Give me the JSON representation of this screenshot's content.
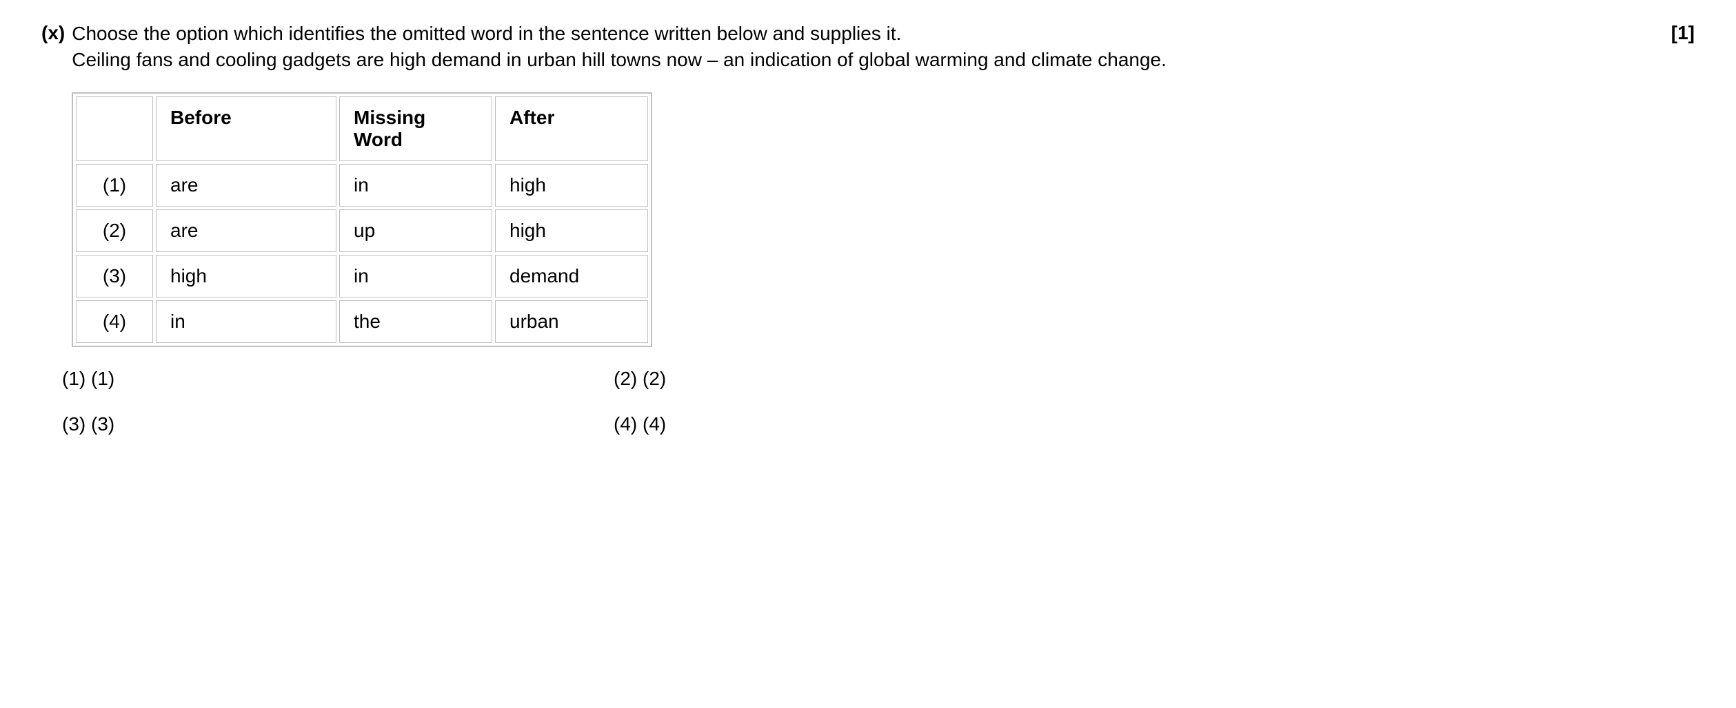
{
  "question": {
    "number": "(x)",
    "prompt": "Choose the option which identifies the omitted word in the sentence written below and supplies it.",
    "sentence": "Ceiling fans and cooling gadgets are high demand in urban hill towns now – an indication of global warming and climate change.",
    "marks": "[1]"
  },
  "table": {
    "headers": {
      "blank": "",
      "before": "Before",
      "missing": "Missing Word",
      "after": "After"
    },
    "rows": [
      {
        "label": "(1)",
        "before": "are",
        "missing": "in",
        "after": "high"
      },
      {
        "label": "(2)",
        "before": "are",
        "missing": "up",
        "after": "high"
      },
      {
        "label": "(3)",
        "before": "high",
        "missing": "in",
        "after": "demand"
      },
      {
        "label": "(4)",
        "before": "in",
        "missing": "the",
        "after": "urban"
      }
    ]
  },
  "answers": [
    {
      "num": "(1)",
      "text": "(1)"
    },
    {
      "num": "(2)",
      "text": "(2)"
    },
    {
      "num": "(3)",
      "text": "(3)"
    },
    {
      "num": "(4)",
      "text": "(4)"
    }
  ]
}
